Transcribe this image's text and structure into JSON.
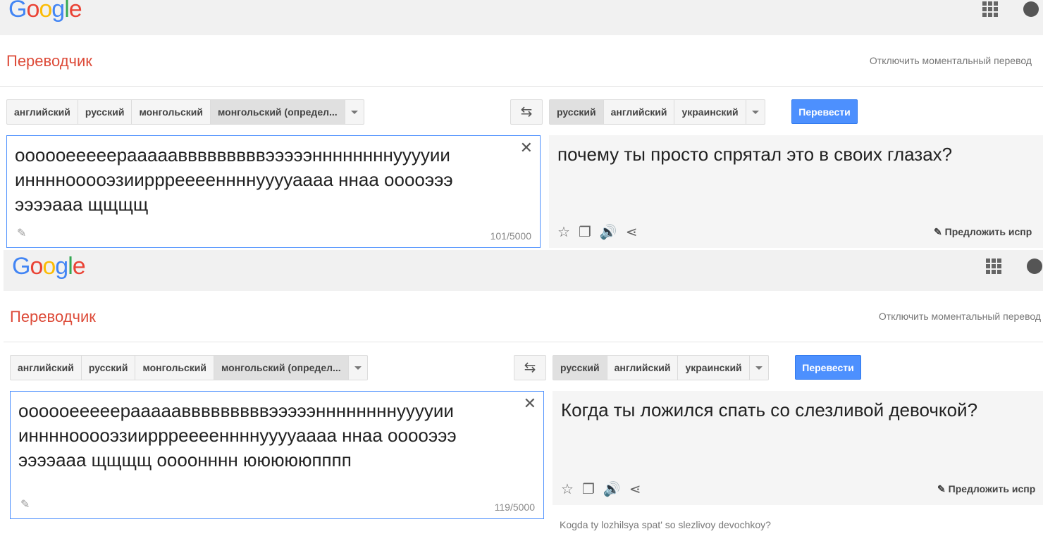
{
  "colors": {
    "accent": "#4d90fe",
    "title": "#dd4b39"
  },
  "logo": "Google",
  "screens": [
    {
      "app_title": "Переводчик",
      "instant_toggle": "Отключить моментальный перевод",
      "source_langs": [
        "английский",
        "русский",
        "монгольский",
        "монгольский (определ..."
      ],
      "target_langs": [
        "русский",
        "английский",
        "украинский"
      ],
      "translate_label": "Перевести",
      "source_text": "оооооееееерааааавввввввввэээээннннннннууууии иннннооооэзиирррееееннннууууаааа ннаа ооооэээ ээээааа щщщщ",
      "char_count": "101/5000",
      "result_text": "почему ты просто спрятал это в своих глазах?",
      "suggest_label": "Предложить испр"
    },
    {
      "app_title": "Переводчик",
      "instant_toggle": "Отключить моментальный перевод",
      "source_langs": [
        "английский",
        "русский",
        "монгольский",
        "монгольский (определ..."
      ],
      "target_langs": [
        "русский",
        "английский",
        "украинский"
      ],
      "translate_label": "Перевести",
      "source_text": "оооооееееерааааавввввввввэээээннннннннууууии иннннооооэзиирррееееннннууууаааа ннаа ооооэээ ээээааа щщщщ оооонннн юююююпппп",
      "char_count": "119/5000",
      "result_text": "Когда ты ложился спать со слезливой девочкой?",
      "suggest_label": "Предложить испр",
      "transliteration": "Kogda ty lozhilsya spat' so slezlivoy devochkoy?"
    }
  ]
}
